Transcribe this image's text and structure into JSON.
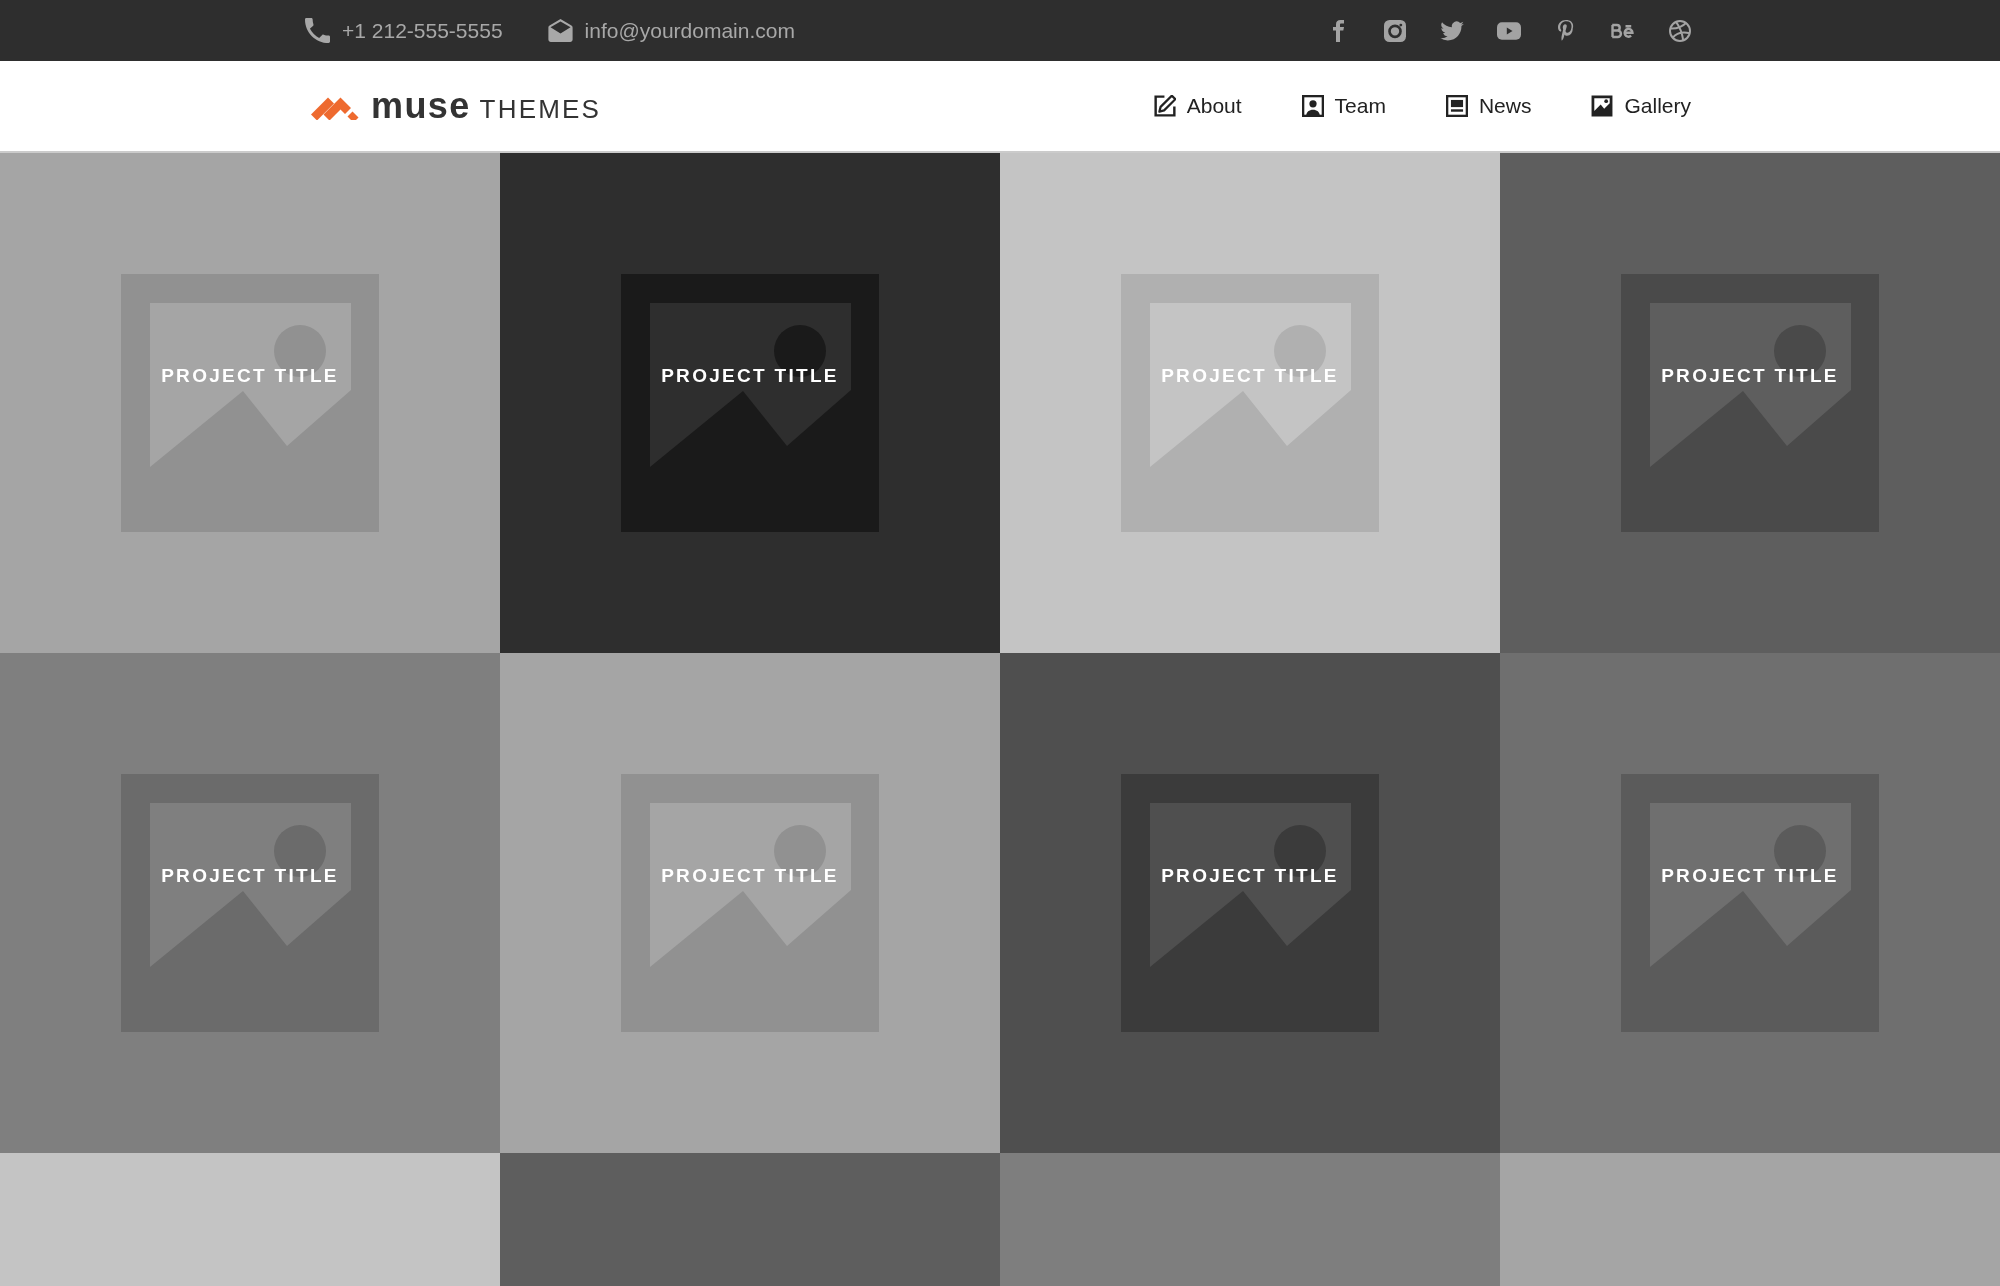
{
  "top_bar": {
    "phone": "+1 212-555-5555",
    "email": "info@yourdomain.com"
  },
  "header": {
    "logo": "**muse** THEMES",
    "nav": [
      {
        "label": "About"
      },
      {
        "label": "Team"
      },
      {
        "label": "News"
      },
      {
        "label": "Gallery"
      }
    ]
  },
  "projects": [
    {
      "title": "PROJECT TITLE",
      "color": "#a5a5a5"
    },
    {
      "title": "PROJECT TITLE",
      "color": "#2e2e2e"
    },
    {
      "title": "PROJECT TITLE",
      "color": "#c4c4c4"
    },
    {
      "title": "PROJECT TITLE",
      "color": "#5e5e5e"
    },
    {
      "title": "PROJECT TITLE",
      "color": "#7f7f7f"
    },
    {
      "title": "PROJECT TITLE",
      "color": "#a5a5a5"
    },
    {
      "title": "PROJECT TITLE",
      "color": "#4f4f4f"
    },
    {
      "title": "PROJECT TITLE",
      "color": "#6f6f6f"
    },
    {
      "color": "#c4c4c4"
    },
    {
      "color": "#5e5e5e"
    },
    {
      "color": "#7e7e7e"
    },
    {
      "color": "#a5a5a5"
    }
  ]
}
